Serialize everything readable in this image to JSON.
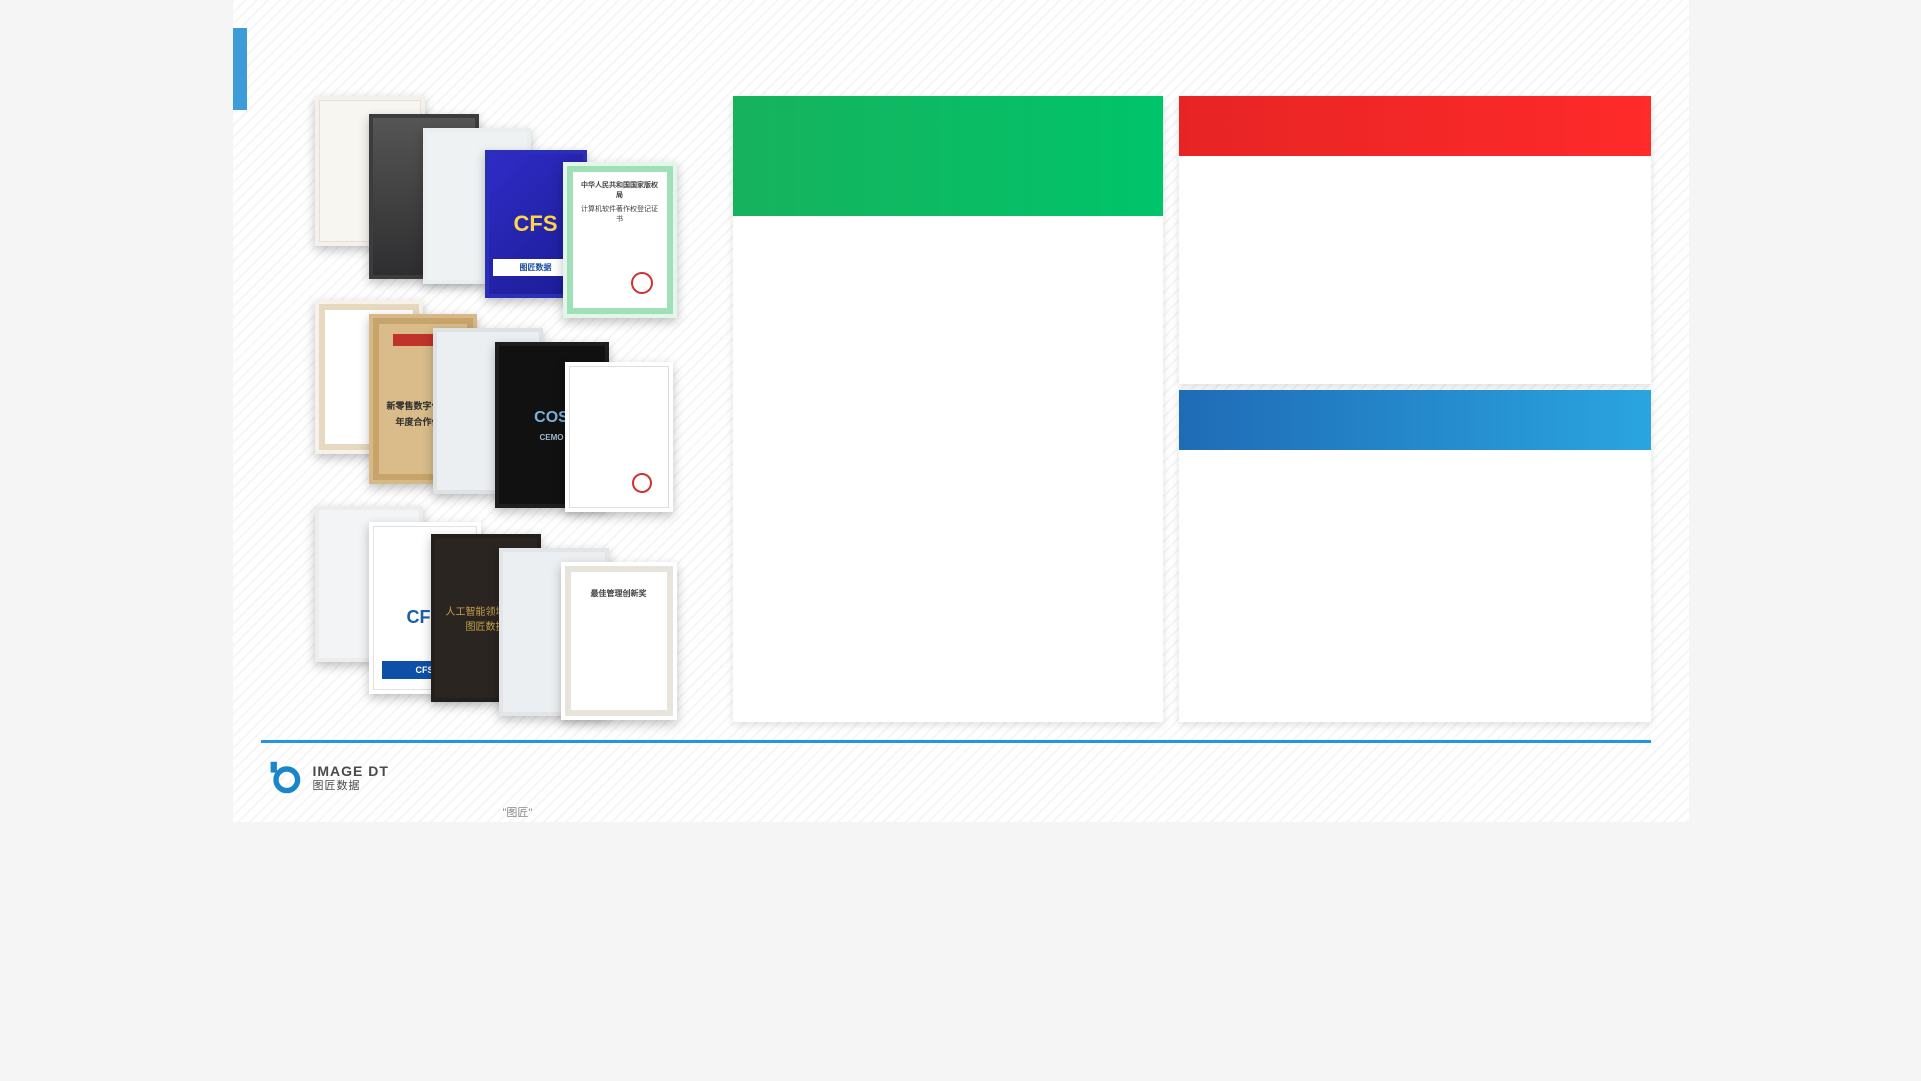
{
  "footer": {
    "brand_en": "IMAGE DT",
    "brand_cn": "图匠数据",
    "page_note": "\"图匠\""
  },
  "collage": {
    "r1d_label": "CFS",
    "r1d_banner": "图匠数据",
    "r1e_title": "中华人民共和国国家版权局",
    "r1e_sub": "计算机软件著作权登记证书",
    "r2b_line1": "新零售数字化核心",
    "r2b_line2": "年度合作伙伴",
    "r2d_label": "COS",
    "r2d_sub": "CEMO",
    "r3b_brand": "CFS",
    "r3b_cfs_badge": "CFS",
    "r3c_text": "人工智能领域精英\n图匠数据",
    "r3e_caption": "最佳管理创新奖"
  },
  "panels": {
    "green_title": "",
    "red_title": "",
    "blue_title": ""
  }
}
